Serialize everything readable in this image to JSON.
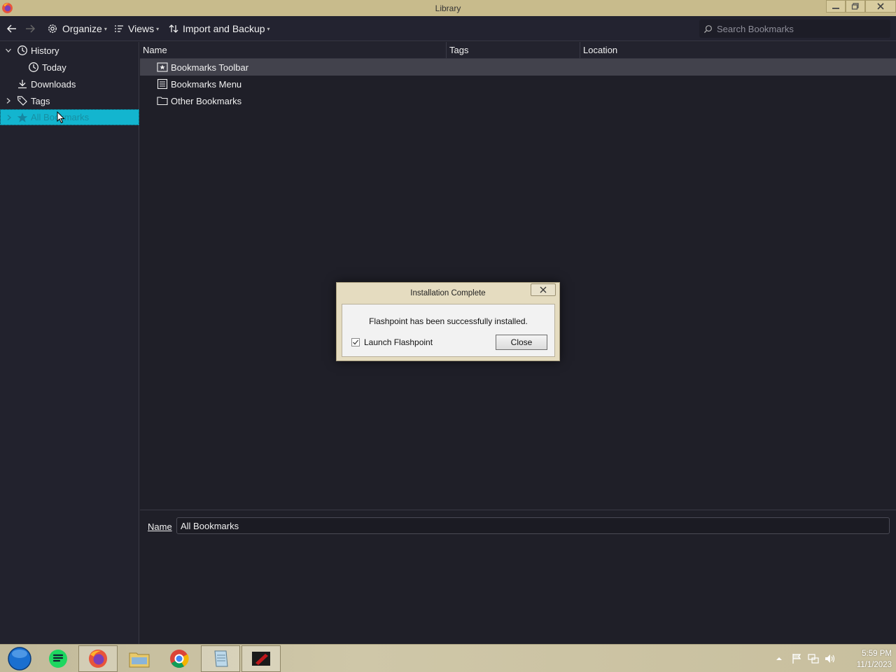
{
  "window": {
    "title": "Library",
    "buttons": [
      "minimize",
      "restore",
      "close"
    ]
  },
  "toolbar": {
    "organize_label": "Organize",
    "views_label": "Views",
    "import_label": "Import and Backup",
    "search_placeholder": "Search Bookmarks"
  },
  "sidebar": {
    "items": [
      {
        "label": "History",
        "icon": "clock-icon",
        "expanded": true
      },
      {
        "label": "Today",
        "icon": "clock-icon"
      },
      {
        "label": "Downloads",
        "icon": "download-icon"
      },
      {
        "label": "Tags",
        "icon": "tag-icon",
        "expanded": false
      },
      {
        "label": "All Bookmarks",
        "icon": "star-icon",
        "selected": true
      }
    ]
  },
  "list": {
    "columns": [
      "Name",
      "Tags",
      "Location"
    ],
    "rows": [
      {
        "name": "Bookmarks Toolbar",
        "icon": "bookmarks-toolbar-icon",
        "selected": true
      },
      {
        "name": "Bookmarks Menu",
        "icon": "bookmarks-menu-icon"
      },
      {
        "name": "Other Bookmarks",
        "icon": "folder-icon"
      }
    ]
  },
  "details": {
    "name_label": "Name",
    "name_value": "All Bookmarks"
  },
  "dialog": {
    "title": "Installation Complete",
    "message": "Flashpoint has been successfully installed.",
    "checkbox_label": "Launch Flashpoint",
    "checkbox_checked": true,
    "close_button": "Close"
  },
  "taskbar": {
    "apps": [
      "start-orb-icon",
      "notes-app-icon",
      "firefox-icon",
      "file-explorer-icon",
      "chrome-icon",
      "notepad-icon",
      "flashpoint-icon"
    ],
    "clock_time": "5:59 PM",
    "clock_date": "11/1/2023"
  },
  "colors": {
    "background": "#1f1f28",
    "selection": "#13b5cf",
    "titlebar": "#c8bb8c"
  }
}
